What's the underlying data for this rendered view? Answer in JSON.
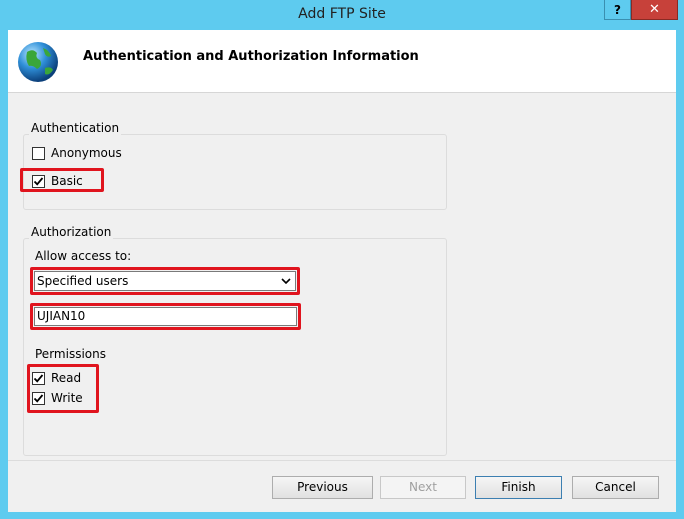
{
  "window": {
    "title": "Add FTP Site",
    "help_label": "?",
    "close_label": "✕"
  },
  "header": {
    "title": "Authentication and Authorization Information",
    "icon": "globe-icon"
  },
  "authentication": {
    "group_label": "Authentication",
    "anonymous": {
      "label": "Anonymous",
      "checked": false
    },
    "basic": {
      "label": "Basic",
      "checked": true
    }
  },
  "authorization": {
    "group_label": "Authorization",
    "allow_access_label": "Allow access to:",
    "allow_access_value": "Specified users",
    "users_value": "UJIAN10",
    "permissions_label": "Permissions",
    "read": {
      "label": "Read",
      "checked": true
    },
    "write": {
      "label": "Write",
      "checked": true
    }
  },
  "buttons": {
    "previous": "Previous",
    "next": "Next",
    "finish": "Finish",
    "cancel": "Cancel"
  },
  "colors": {
    "highlight": "#e0141e",
    "titlebar": "#5ecbef",
    "close": "#c7413a"
  }
}
